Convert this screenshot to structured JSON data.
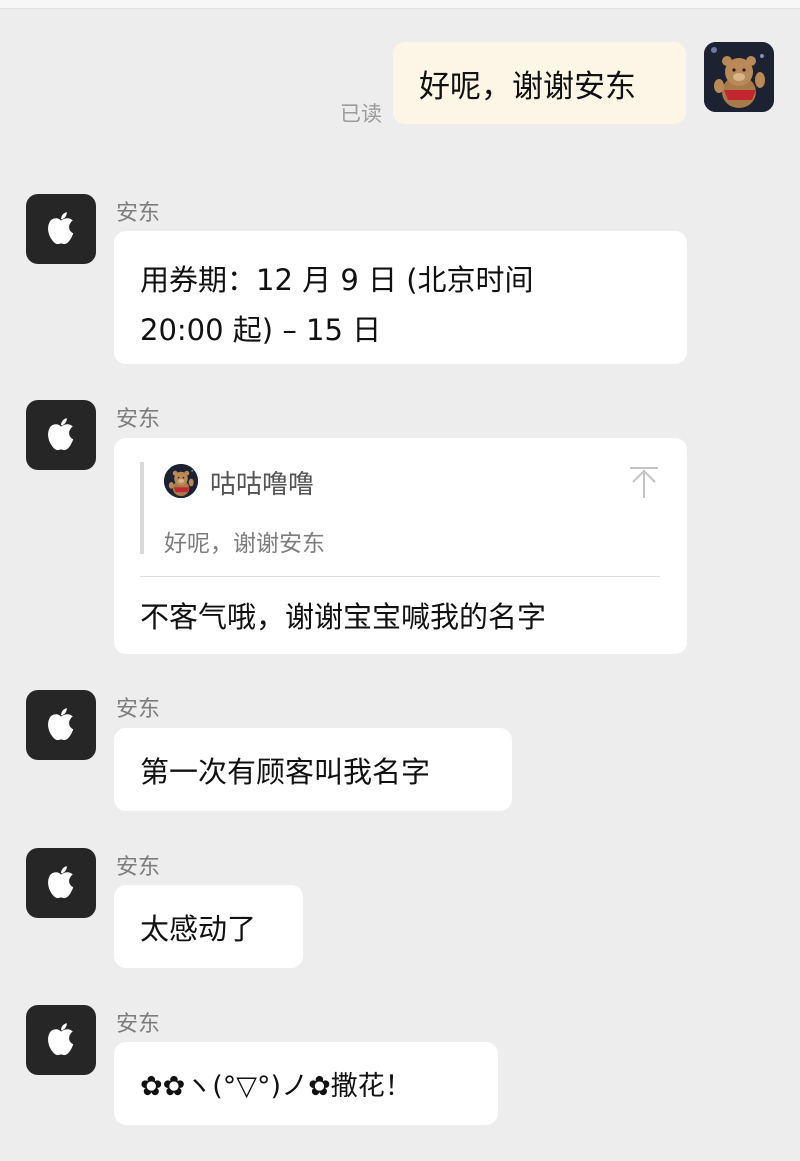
{
  "me": {
    "avatar_icon": "teddy-bear-avatar",
    "message": "好呢，谢谢安东",
    "read_status": "已读"
  },
  "contact": {
    "name": "安东",
    "avatar_icon": "apple-logo-icon"
  },
  "messages": [
    {
      "text_line1": "用券期：12 月 9 日 (北京时间",
      "text_line2": "20:00 起) – 15 日"
    },
    {
      "quote": {
        "author": "咕咕噜噜",
        "text": "好呢，谢谢安东",
        "pin_icon": "pin-top-icon"
      },
      "text": "不客气哦，谢谢宝宝喊我的名字"
    },
    {
      "text": "第一次有顾客叫我名字"
    },
    {
      "text": "太感动了"
    },
    {
      "text": "✿✿ヽ(°▽°)ノ✿撒花！"
    }
  ],
  "colors": {
    "background": "#ededed",
    "incoming_bubble": "#ffffff",
    "outgoing_bubble": "#fdf6e6"
  }
}
